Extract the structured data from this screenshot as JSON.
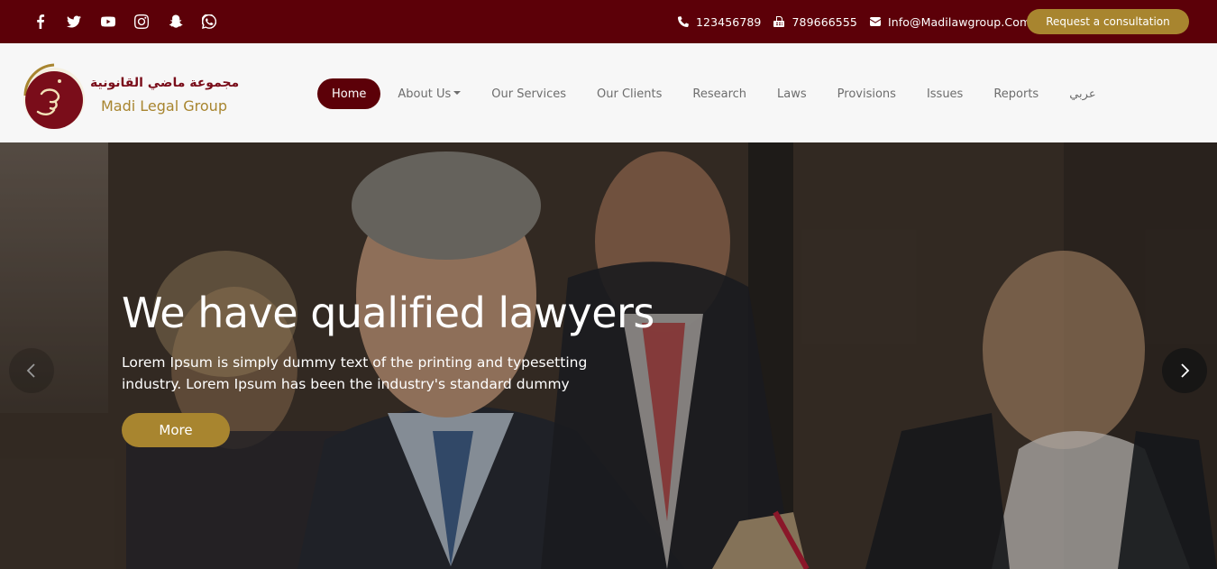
{
  "topbar": {
    "social": [
      "facebook-icon",
      "twitter-icon",
      "youtube-icon",
      "instagram-icon",
      "snapchat-icon",
      "whatsapp-icon"
    ],
    "phone": "123456789",
    "fax": "789666555",
    "email": "Info@Madilawgroup.Com",
    "consult_label": "Request a consultation"
  },
  "logo": {
    "arabic": "مجموعة ماضي القانونية",
    "english": "Madi Legal Group"
  },
  "nav": {
    "items": [
      {
        "label": "Home",
        "active": true
      },
      {
        "label": "About Us",
        "dropdown": true
      },
      {
        "label": "Our Services"
      },
      {
        "label": "Our Clients"
      },
      {
        "label": "Research"
      },
      {
        "label": "Laws"
      },
      {
        "label": "Provisions"
      },
      {
        "label": "Issues"
      },
      {
        "label": "Reports"
      },
      {
        "label": "عربي"
      }
    ]
  },
  "hero": {
    "title": "We have qualified lawyers",
    "text": "Lorem Ipsum is simply dummy text of the printing and typesetting industry. Lorem Ipsum has been the industry's standard dummy",
    "more_label": "More"
  },
  "colors": {
    "brand": "#5c0008",
    "accent": "#a8852f"
  }
}
